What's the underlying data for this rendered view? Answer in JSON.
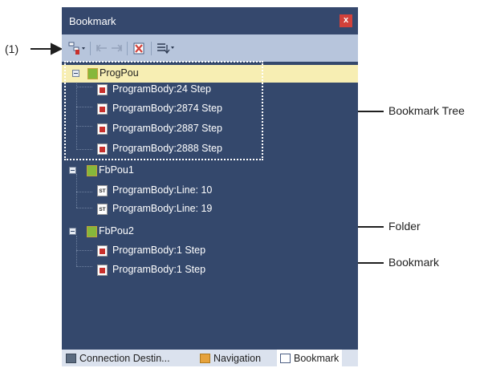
{
  "panel": {
    "title": "Bookmark",
    "close_label": "x"
  },
  "tree": {
    "folders": [
      {
        "label": "ProgPou",
        "icon": "folder-ld-icon",
        "items": [
          {
            "label": "ProgramBody:24 Step",
            "icon": "ladder-program-icon"
          },
          {
            "label": "ProgramBody:2874 Step",
            "icon": "ladder-program-icon"
          },
          {
            "label": "ProgramBody:2887 Step",
            "icon": "ladder-program-icon"
          },
          {
            "label": "ProgramBody:2888 Step",
            "icon": "ladder-program-icon"
          }
        ]
      },
      {
        "label": "FbPou1",
        "icon": "folder-icon",
        "items": [
          {
            "label": "ProgramBody:Line: 10",
            "icon": "st-program-icon"
          },
          {
            "label": "ProgramBody:Line: 19",
            "icon": "st-program-icon"
          }
        ]
      },
      {
        "label": "FbPou2",
        "icon": "folder-icon",
        "items": [
          {
            "label": "ProgramBody:1 Step",
            "icon": "ladder-program-icon"
          },
          {
            "label": "ProgramBody:1 Step",
            "icon": "ladder-program-icon"
          }
        ]
      }
    ]
  },
  "tabs": [
    {
      "label": "Connection Destin...",
      "active": false
    },
    {
      "label": "Navigation",
      "active": false
    },
    {
      "label": "Bookmark",
      "active": true
    }
  ],
  "callouts": {
    "toolbar": "(1)",
    "bookmark_tree": "Bookmark Tree",
    "folder": "Folder",
    "bookmark": "Bookmark"
  },
  "icons": {
    "st_glyph": "ST"
  },
  "colors": {
    "title_bar": "#35486d",
    "toolbar": "#b7c5dc",
    "tree_bg": "#34486c",
    "selection": "#f7eeb3",
    "close": "#d2413a"
  }
}
